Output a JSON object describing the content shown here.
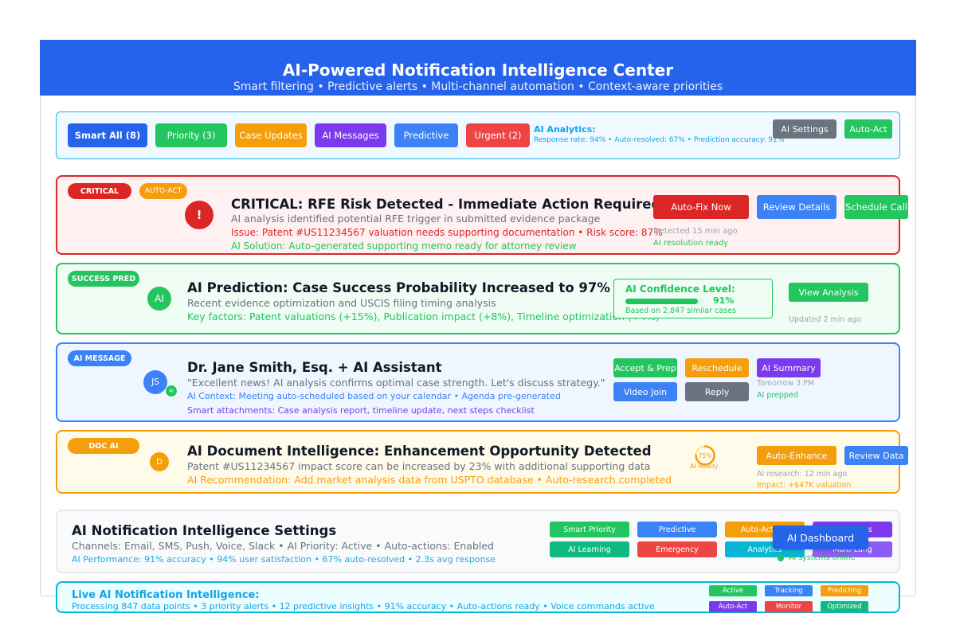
{
  "header": {
    "title": "AI-Powered Notification Intelligence Center",
    "subtitle": "Smart filtering • Predictive alerts • Multi-channel automation • Context-aware priorities"
  },
  "filters": {
    "chips": [
      "Smart All (8)",
      "Priority (3)",
      "Case Updates",
      "AI Messages",
      "Predictive",
      "Urgent (2)"
    ],
    "analytics_label": "AI Analytics:",
    "analytics_text": "Response rate: 94% • Auto-resolved: 67% • Prediction accuracy: 91%",
    "settings_button": "AI Settings",
    "autoact_button": "Auto-Act"
  },
  "critical": {
    "badge": "CRITICAL",
    "auto_badge": "AUTO-ACT",
    "icon_glyph": "!",
    "title": "CRITICAL: RFE Risk Detected - Immediate Action Required",
    "line1": "AI analysis identified potential RFE trigger in submitted evidence package",
    "line2": "Issue: Patent #US11234567 valuation needs supporting documentation • Risk score: 87%",
    "line3": "AI Solution: Auto-generated supporting memo ready for attorney review",
    "btn_fix": "Auto-Fix Now",
    "btn_review": "Review Details",
    "btn_schedule": "Schedule Call",
    "detected": "Detected 15 min ago",
    "resolution": "AI resolution ready"
  },
  "success": {
    "badge": "SUCCESS PRED",
    "avatar": "AI",
    "title": "AI Prediction: Case Success Probability Increased to 97%",
    "line1": "Recent evidence optimization and USCIS filing timing analysis",
    "line2": "Key factors: Patent valuations (+15%), Publication impact (+8%), Timeline optimization (+4%)",
    "confidence_label": "AI Confidence Level:",
    "confidence_value": "91%",
    "confidence_fraction": 0.91,
    "confidence_basis": "Based on 2,847 similar cases",
    "btn_view": "View Analysis",
    "updated": "Updated 2 min ago"
  },
  "message": {
    "badge": "AI MESSAGE",
    "avatar": "JS",
    "avatar_ai": "AI",
    "title": "Dr. Jane Smith, Esq. + AI Assistant",
    "quote": "\"Excellent news! AI analysis confirms optimal case strength. Let's discuss strategy.\"",
    "context": "AI Context: Meeting auto-scheduled based on your calendar • Agenda pre-generated",
    "attachments": "Smart attachments: Case analysis report, timeline update, next steps checklist",
    "btn_accept": "Accept & Prep",
    "btn_reschedule": "Reschedule",
    "btn_summary": "AI Summary",
    "btn_video": "Video Join",
    "btn_reply": "Reply",
    "when": "Tomorrow 3 PM",
    "prepped": "AI prepped"
  },
  "doc": {
    "badge": "DOC AI",
    "avatar": "D",
    "title": "AI Document Intelligence: Enhancement Opportunity Detected",
    "line1": "Patent #US11234567 impact score can be increased by 23% with additional supporting data",
    "line2": "AI Recommendation: Add market analysis data from USPTO database • Auto-research completed",
    "ring_value": "75%",
    "ring_fraction": 0.75,
    "ring_label": "AI Ready",
    "btn_enhance": "Auto-Enhance",
    "btn_review": "Review Data",
    "research": "AI research: 12 min ago",
    "impact": "Impact: +$47K valuation"
  },
  "settings": {
    "title": "AI Notification Intelligence Settings",
    "channels": "Channels: Email, SMS, Push, Voice, Slack • AI Priority: Active • Auto-actions: Enabled",
    "performance": "AI Performance: 91% accuracy • 94% user satisfaction • 67% auto-resolved • 2.3s avg response",
    "tiles": [
      "Smart Priority",
      "Predictive",
      "Auto-Actions",
      "AI Insights",
      "AI Learning",
      "Emergency",
      "Analytics",
      "Multi-Lang"
    ],
    "dashboard_button": "AI Dashboard",
    "systems_status": "AI systems online"
  },
  "live": {
    "title": "Live AI Notification Intelligence:",
    "text": "Processing 847 data points • 3 priority alerts • 12 predictive insights • 91% accuracy • Auto-actions ready • Voice commands active",
    "tags": [
      "Active",
      "Tracking",
      "Predicting",
      "Auto-Act",
      "Monitor",
      "Optimized"
    ]
  },
  "colors": {
    "primary": "#2563eb",
    "critical": "#dc2626",
    "success": "#22c55e",
    "info": "#3b82f6",
    "warning": "#f59e0b",
    "purple": "#7c3aed",
    "gray": "#6b7280",
    "cyan": "#06b6d4"
  }
}
